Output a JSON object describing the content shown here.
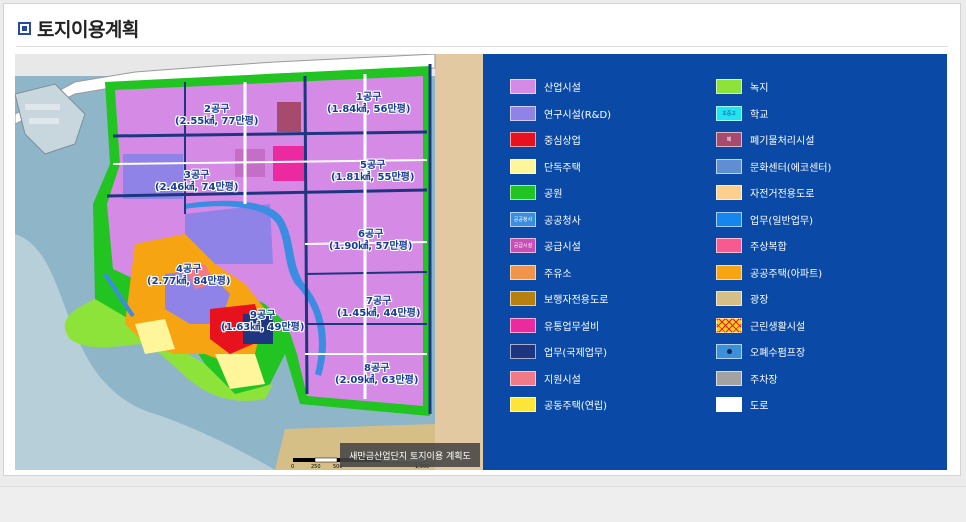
{
  "page_title": "토지이용계획",
  "map": {
    "caption": "새만금산업단지 토지이용 계획도",
    "scale_labels": [
      "0",
      "250",
      "500",
      "1,000"
    ],
    "districts": [
      {
        "name": "1공구",
        "area": "(1.84㎢, 56만평)"
      },
      {
        "name": "2공구",
        "area": "(2.55㎢, 77만평)"
      },
      {
        "name": "3공구",
        "area": "(2.46㎢, 74만평)"
      },
      {
        "name": "4공구",
        "area": "(2.77㎢, 84만평)"
      },
      {
        "name": "5공구",
        "area": "(1.81㎢, 55만평)"
      },
      {
        "name": "6공구",
        "area": "(1.90㎢, 57만평)"
      },
      {
        "name": "7공구",
        "area": "(1.45㎢, 44만평)"
      },
      {
        "name": "8공구",
        "area": "(2.09㎢, 63만평)"
      },
      {
        "name": "9공구",
        "area": "(1.63㎢, 49만평)"
      }
    ]
  },
  "legend": {
    "left": [
      {
        "label": "산업시설",
        "color": "#d58ae6"
      },
      {
        "label": "연구시설(R&D)",
        "color": "#8f83e8"
      },
      {
        "label": "중심상업",
        "color": "#e8121e"
      },
      {
        "label": "단독주택",
        "color": "#fff59a"
      },
      {
        "label": "공원",
        "color": "#22c422"
      },
      {
        "label": "공공청사",
        "color": "#3a8de0",
        "text": "공공청사"
      },
      {
        "label": "공급시설",
        "color": "#c84fb5",
        "text": "공급시설"
      },
      {
        "label": "주유소",
        "color": "#ef9448"
      },
      {
        "label": "보행자전용도로",
        "color": "#b8800e"
      },
      {
        "label": "유통업무설비",
        "color": "#ec2a9f"
      },
      {
        "label": "업무(국제업무)",
        "color": "#1e3680"
      },
      {
        "label": "지원시설",
        "color": "#f27a86"
      },
      {
        "label": "공동주택(연립)",
        "color": "#ffe43a"
      }
    ],
    "right": [
      {
        "label": "녹지",
        "color": "#8ee33a"
      },
      {
        "label": "학교",
        "color": "#22e3f0",
        "text": "초중고"
      },
      {
        "label": "폐기물처리시설",
        "color": "#a64a6e",
        "text": "폐"
      },
      {
        "label": "문화센터(에코센터)",
        "color": "#5f8fd2"
      },
      {
        "label": "자전거전용도로",
        "color": "#fdcf8e"
      },
      {
        "label": "업무(일반업무)",
        "color": "#1586ee"
      },
      {
        "label": "주상복합",
        "color": "#f75a91"
      },
      {
        "label": "공공주택(아파트)",
        "color": "#f6a412"
      },
      {
        "label": "광장",
        "color": "#d6bf86"
      },
      {
        "label": "근린생활시설",
        "color": "#f4d21a",
        "pattern": "cross"
      },
      {
        "label": "오폐수펌프장",
        "color": "#3d8fd8",
        "pattern": "dot"
      },
      {
        "label": "주차장",
        "color": "#a2a2a2"
      },
      {
        "label": "도로",
        "color": "#ffffff"
      }
    ]
  }
}
